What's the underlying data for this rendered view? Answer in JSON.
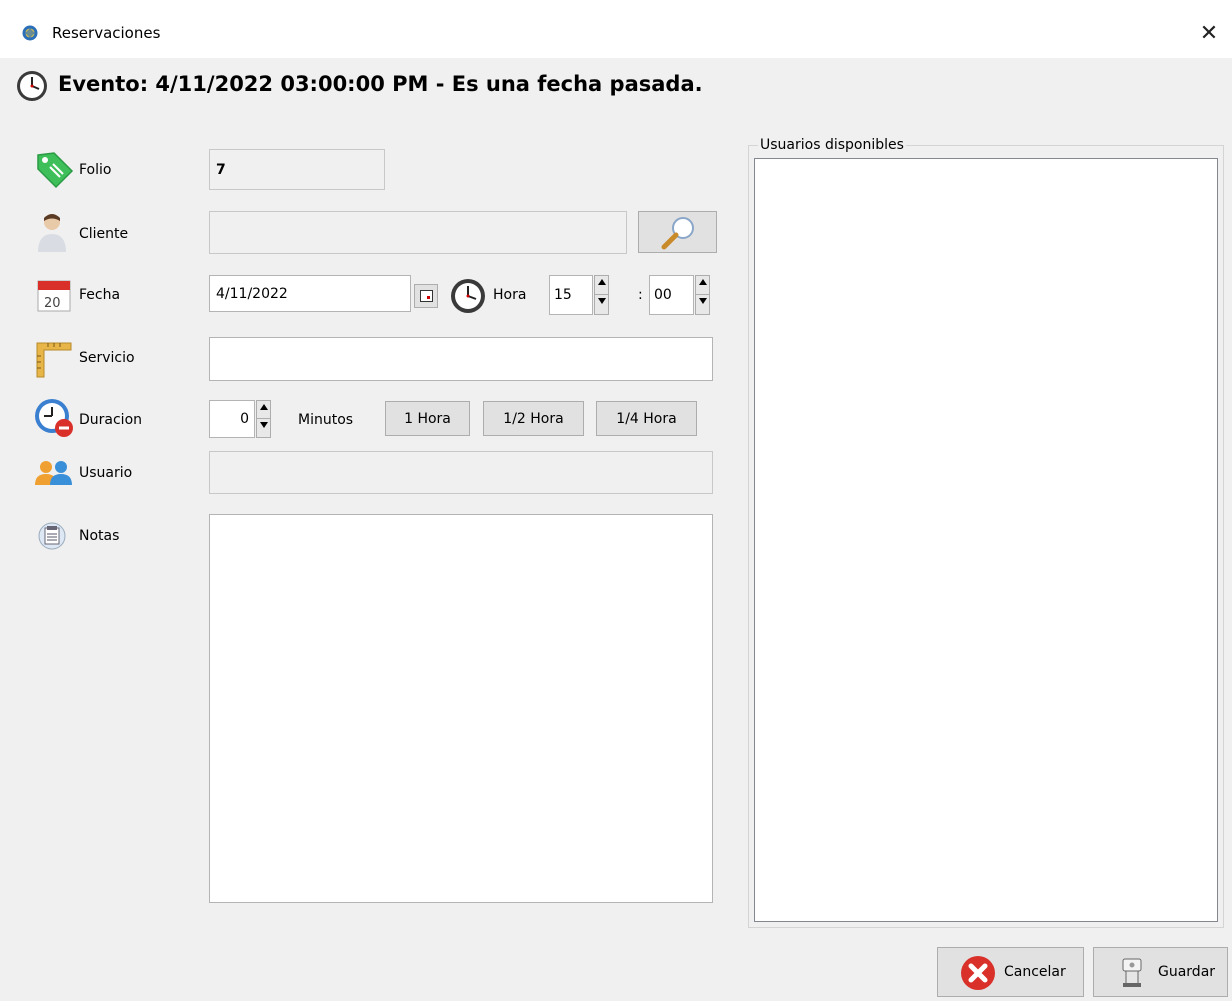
{
  "window": {
    "title": "Reservaciones",
    "close_glyph": "✕"
  },
  "heading": {
    "text": "Evento: 4/11/2022 03:00:00 PM - Es una fecha pasada.",
    "icon": "clock-icon"
  },
  "form": {
    "folio": {
      "label": "Folio",
      "value": "7",
      "icon": "tag-icon"
    },
    "cliente": {
      "label": "Cliente",
      "value": "",
      "icon": "person-icon",
      "search_icon": "search-icon"
    },
    "fecha": {
      "label": "Fecha",
      "value": "4/11/2022",
      "icon": "calendar-icon"
    },
    "hora": {
      "label": "Hora",
      "hour": "15",
      "separator": ":",
      "minute": "00",
      "icon": "clock-icon"
    },
    "servicio": {
      "label": "Servicio",
      "value": "",
      "icon": "ruler-icon"
    },
    "duracion": {
      "label": "Duracion",
      "value": "0",
      "units_label": "Minutos",
      "icon": "duration-clock-icon",
      "presets": [
        "1 Hora",
        "1/2 Hora",
        "1/4 Hora"
      ]
    },
    "usuario": {
      "label": "Usuario",
      "value": "",
      "icon": "users-icon"
    },
    "notas": {
      "label": "Notas",
      "value": "",
      "icon": "notepad-icon"
    }
  },
  "users_panel": {
    "title": "Usuarios disponibles",
    "items": []
  },
  "actions": {
    "cancel_label": "Cancelar",
    "save_label": "Guardar"
  },
  "colors": {
    "cancel_red": "#d9302a",
    "tag_green": "#3fbf5a",
    "users_orange": "#f0a030",
    "users_blue": "#3a8fd9"
  }
}
